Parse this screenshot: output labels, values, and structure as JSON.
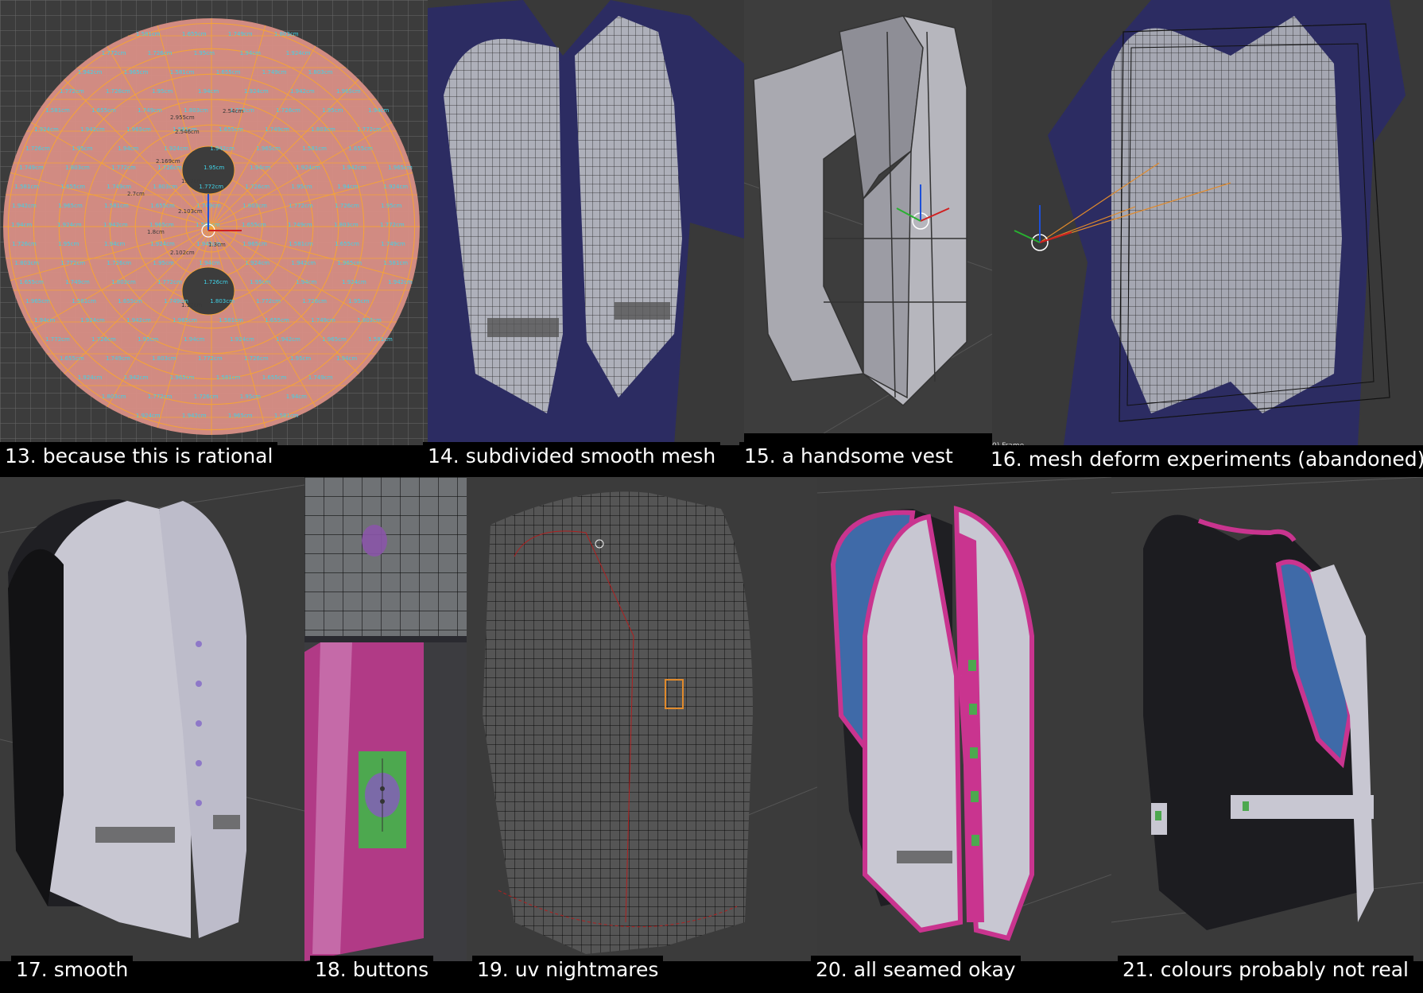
{
  "captions": {
    "p13": "13. because this is rational",
    "p14": "14. subdivided smooth mesh",
    "p15": "15. a handsome vest",
    "p16": "16. mesh deform experiments (abandoned)",
    "p17": "17. smooth",
    "p18": "18. buttons",
    "p19": "19. uv nightmares",
    "p20": "20. all seamed okay",
    "p21": "21. colours probably not real"
  },
  "frame_label": "0) Frame",
  "uv_pattern_labels": {
    "rings": [
      "1.581cm",
      "1.655cm",
      "1.749cm",
      "1.803cm",
      "1.772cm",
      "1.726cm"
    ],
    "columns": [
      "1.95cm",
      "1.94cm",
      "1.924cm",
      "1.942cm",
      "1.965cm"
    ],
    "inner": [
      "2.955cm",
      "2.54cm",
      "2.546cm",
      "2.169cm",
      "1.17cm",
      "2.7cm",
      "2.103cm",
      "2.102cm",
      "1.8cm",
      "1.3cm",
      "1.17cm"
    ]
  },
  "colors": {
    "viewport_bg": "#3a3a3a",
    "uv_pink": "#d98f86",
    "uv_edge": "#f3a23a",
    "uv_label": "#3fd3e8",
    "vest_white": "#c8c7d2",
    "vest_dark": "#2a2a2e",
    "trim_magenta": "#c9348f",
    "lining_blue": "#3f6aa8",
    "shirt_blue": "#2e2e6a"
  }
}
